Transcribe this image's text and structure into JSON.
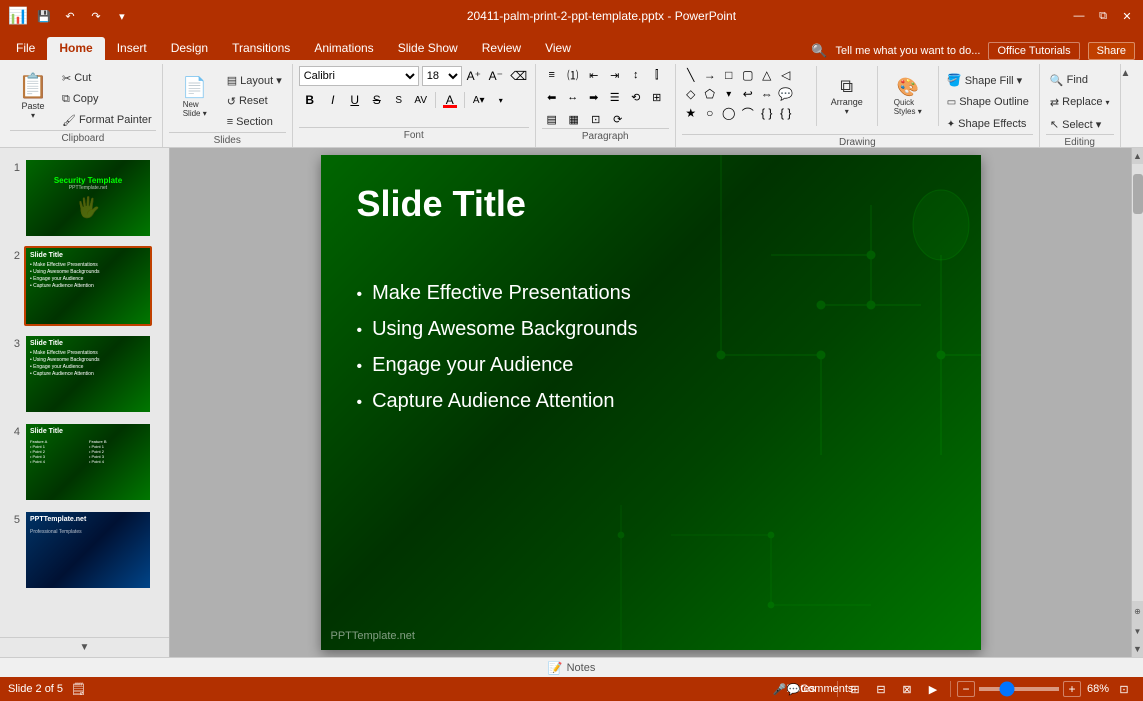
{
  "titlebar": {
    "filename": "20411-palm-print-2-ppt-template.pptx - PowerPoint",
    "qat_buttons": [
      "save",
      "undo",
      "redo",
      "more"
    ],
    "win_buttons": [
      "minimize",
      "restore",
      "close"
    ],
    "app_icon": "📊"
  },
  "ribbon": {
    "tabs": [
      "File",
      "Home",
      "Insert",
      "Design",
      "Transitions",
      "Animations",
      "Slide Show",
      "Review",
      "View"
    ],
    "active_tab": "Home",
    "right_buttons": [
      "Office Tutorials",
      "Share"
    ],
    "tell_me": "Tell me what you want to do...",
    "groups": {
      "clipboard": {
        "label": "Clipboard",
        "paste_label": "Paste",
        "buttons": [
          "Cut",
          "Copy",
          "Format Painter"
        ]
      },
      "slides": {
        "label": "Slides",
        "buttons": [
          "New Slide",
          "Layout",
          "Reset",
          "Section"
        ]
      },
      "font": {
        "label": "Font",
        "font_name": "Calibri",
        "font_size": "18",
        "bold": "B",
        "italic": "I",
        "underline": "U",
        "strikethrough": "S",
        "grow": "A+",
        "shrink": "A-"
      },
      "paragraph": {
        "label": "Paragraph"
      },
      "drawing": {
        "label": "Drawing",
        "shape_fill": "Shape Fill ▾",
        "shape_outline": "Shape Outline",
        "shape_effects": "Shape Effects",
        "arrange": "Arrange",
        "quick_styles": "Quick Styles"
      },
      "editing": {
        "label": "Editing",
        "find": "Find",
        "replace": "Replace",
        "select": "Select ▾"
      }
    }
  },
  "slide_panel": {
    "slides": [
      {
        "number": "1",
        "type": "title"
      },
      {
        "number": "2",
        "type": "content",
        "active": true
      },
      {
        "number": "3",
        "type": "content"
      },
      {
        "number": "4",
        "type": "table"
      },
      {
        "number": "5",
        "type": "blue"
      }
    ]
  },
  "main_slide": {
    "title": "Slide Title",
    "bullets": [
      "Make Effective Presentations",
      "Using Awesome Backgrounds",
      "Engage your Audience",
      "Capture Audience Attention"
    ],
    "watermark": "PPTTemplate.net"
  },
  "status_bar": {
    "slide_info": "Slide 2 of 5",
    "notes": "Notes",
    "comments": "Comments",
    "zoom": "68%",
    "view_buttons": [
      "normal",
      "outline",
      "slide_sorter",
      "reading",
      "presenter"
    ]
  }
}
